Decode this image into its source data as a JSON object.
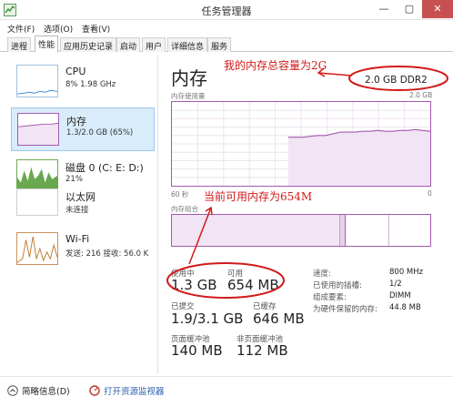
{
  "window": {
    "title": "任务管理器",
    "min": "—",
    "max": "▢",
    "close": "✕"
  },
  "menu": [
    "文件(F)",
    "选项(O)",
    "查看(V)"
  ],
  "tabs": [
    "进程",
    "性能",
    "应用历史记录",
    "启动",
    "用户",
    "详细信息",
    "服务"
  ],
  "sidebar": [
    {
      "title": "CPU",
      "sub": "8% 1.98 GHz"
    },
    {
      "title": "内存",
      "sub": "1.3/2.0 GB (65%)"
    },
    {
      "title": "磁盘 0 (C: E: D:)",
      "sub": "21%"
    },
    {
      "title": "以太网",
      "sub": "未连接"
    },
    {
      "title": "Wi-Fi",
      "sub": "发送: 216 接收: 56.0 K"
    }
  ],
  "main": {
    "title": "内存",
    "capacity": "2.0 GB DDR2",
    "usage_label": "内存使用量",
    "usage_max": "2.0 GB",
    "time_left": "60 秒",
    "time_right": "0",
    "composition_label": "内存组合",
    "stats": {
      "in_use_label": "使用中",
      "in_use": "1.3 GB",
      "available_label": "可用",
      "available": "654 MB",
      "committed_label": "已提交",
      "committed": "1.9/3.1 GB",
      "cached_label": "已缓存",
      "cached": "646 MB",
      "paged_label": "页面缓冲池",
      "paged": "140 MB",
      "nonpaged_label": "非页面缓冲池",
      "nonpaged": "112 MB"
    },
    "specs": [
      {
        "label": "速度:",
        "value": "800 MHz"
      },
      {
        "label": "已使用的插槽:",
        "value": "1/2"
      },
      {
        "label": "组成要素:",
        "value": "DIMM"
      },
      {
        "label": "为硬件保留的内存:",
        "value": "44.8 MB"
      }
    ]
  },
  "annotations": {
    "top": "我的内存总容量为2G",
    "middle": "当前可用内存为654M"
  },
  "footer": {
    "brief": "简略信息(D)",
    "open_monitor": "打开资源监视器"
  },
  "usage_series": [
    0.58,
    0.58,
    0.58,
    0.59,
    0.6,
    0.6,
    0.62,
    0.64,
    0.64,
    0.64,
    0.65,
    0.65,
    0.66,
    0.65,
    0.65,
    0.66,
    0.66,
    0.67,
    0.66,
    0.65
  ],
  "colors": {
    "memory": "#a45ab0",
    "memory_fill": "#f1e4f4",
    "annotation": "#d21a1a",
    "link": "#2a5db0"
  }
}
